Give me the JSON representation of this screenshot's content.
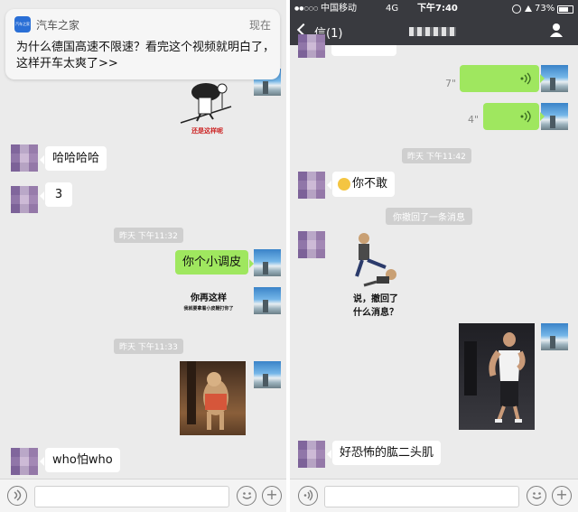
{
  "left": {
    "notification": {
      "app_name": "汽车之家",
      "app_icon_text": "汽车之家",
      "time": "现在",
      "message": "为什么德国高速不限速？看完这个视频就明白了，这样开车太爽了>>"
    },
    "sticker_caption_top": "还是这样呢",
    "messages": {
      "haha": "哈哈哈哈",
      "three": "3",
      "ts1": "昨天 下午11:32",
      "tiaopi": "你个小调皮",
      "sticker2_line1": "你再这样",
      "sticker2_line2": "我就要拿着小皮鞭打你了",
      "ts2": "昨天 下午11:33",
      "whopawho": "who怕who"
    }
  },
  "right": {
    "status": {
      "signal": "●●○○○",
      "carrier": "中国移动",
      "network": "4G",
      "time": "下午7:40",
      "battery": "73%"
    },
    "nav": {
      "title": "信(1)"
    },
    "voice1_duration": "7\"",
    "voice2_duration": "4\"",
    "ts1": "昨天 下午11:42",
    "nibugan": "你不敢",
    "recall_notice": "你撤回了一条消息",
    "sticker_line1": "说，撤回了",
    "sticker_line2": "什么消息？",
    "jirou": "好恐怖的肱二头肌"
  },
  "colors": {
    "chat_bg": "#ebebeb",
    "outgoing": "#9fe75f",
    "incoming": "#ffffff",
    "navbar": "#393a3f"
  }
}
